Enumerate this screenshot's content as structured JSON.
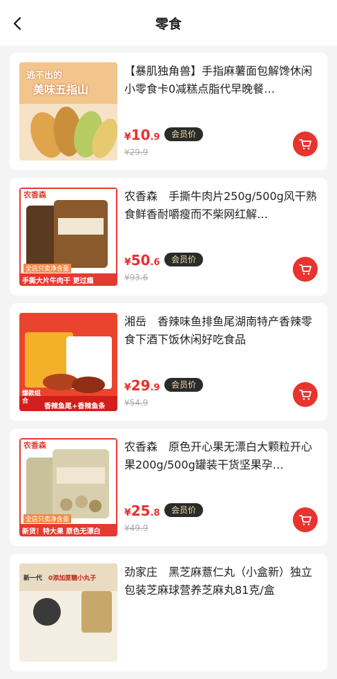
{
  "header": {
    "title": "零食"
  },
  "products": [
    {
      "name": "【暴肌独角兽】手指麻薯面包解馋休闲小零食卡0减糕点脂代早晚餐…",
      "currency": "¥",
      "price_int": "10",
      "price_dec": ".9",
      "member_label": "会员价",
      "original_price": "¥29.9",
      "thumb_text": [
        "逃不出的",
        "美味五指山"
      ]
    },
    {
      "name": "农香森　手撕牛肉片250g/500g风干熟食鲜香耐嚼瘦而不柴网红解…",
      "currency": "¥",
      "price_int": "50",
      "price_dec": ".6",
      "member_label": "会员价",
      "original_price": "¥93.6",
      "thumb_text": [
        "农香森",
        "全店只卖净含量",
        "手撕大片牛肉干 更过瘾"
      ]
    },
    {
      "name": "湘岳　香辣味鱼排鱼尾湖南特产香辣零食下酒下饭休闲好吃食品",
      "currency": "¥",
      "price_int": "29",
      "price_dec": ".9",
      "member_label": "会员价",
      "original_price": "¥54.9",
      "thumb_text": [
        "爆款组合",
        "香辣鱼尾+香辣鱼条"
      ]
    },
    {
      "name": "农香森　原色开心果无漂白大颗粒开心果200g/500g罐装干货坚果孕…",
      "currency": "¥",
      "price_int": "25",
      "price_dec": ".8",
      "member_label": "会员价",
      "original_price": "¥49.9",
      "thumb_text": [
        "农香森",
        "全店只卖净含量",
        "新货！特大果 原色无漂白"
      ]
    },
    {
      "name": "劲家庄　黑芝麻薏仁丸（小盒新）独立包装芝麻球营养芝麻丸81克/盒",
      "currency": "¥",
      "price_int": "",
      "price_dec": "",
      "member_label": "",
      "original_price": "",
      "thumb_text": [
        "新一代",
        "0添加蔗糖小丸子"
      ]
    }
  ],
  "colors": {
    "accent": "#e8302c",
    "member_bg": "#2b2b2b",
    "member_text": "#f3d9a4"
  }
}
